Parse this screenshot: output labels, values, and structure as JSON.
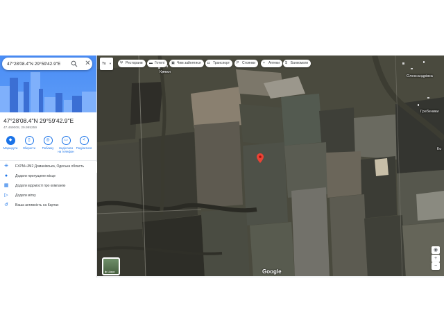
{
  "search": {
    "value": "47°28'08.4\"N 29°59'42.9\"E",
    "close_icon": "close-icon",
    "search_icon": "search-icon"
  },
  "place": {
    "title": "47°28'08.4\"N 29°59'42.9\"E",
    "subtitle": "47.469008, 29.995259"
  },
  "actions": [
    {
      "label": "Маршрути",
      "icon": "directions-icon"
    },
    {
      "label": "Зберегти",
      "icon": "bookmark-icon"
    },
    {
      "label": "Поблизу",
      "icon": "nearby-icon"
    },
    {
      "label": "Надіслати на телефон",
      "icon": "phone-icon"
    },
    {
      "label": "Поділитися",
      "icon": "share-icon"
    }
  ],
  "details": [
    {
      "text": "FXPM+JM2 Доманівська, Одеська область",
      "icon": "pluscode-icon"
    },
    {
      "text": "Додати пропущене місце",
      "icon": "add-place-icon"
    },
    {
      "text": "Додати відомості про компанію",
      "icon": "business-icon"
    },
    {
      "text": "Додати мітку",
      "icon": "label-icon"
    },
    {
      "text": "Ваша активність на Картах",
      "icon": "history-icon"
    }
  ],
  "map": {
    "lang_label": "Yo",
    "chips": [
      {
        "label": "Ресторани",
        "icon": "restaurant-icon"
      },
      {
        "label": "Готелі",
        "icon": "hotel-icon"
      },
      {
        "label": "Чим зайнятися",
        "icon": "activities-icon"
      },
      {
        "label": "Транспорт",
        "icon": "transit-icon"
      },
      {
        "label": "Стоянки",
        "icon": "parking-icon"
      },
      {
        "label": "Аптеки",
        "icon": "pharmacy-icon"
      },
      {
        "label": "Банкомати",
        "icon": "atm-icon"
      }
    ],
    "places": [
      "Кряжи",
      "Олександрівка",
      "Гребеники",
      "Ко"
    ],
    "brand": "Google",
    "layers_label": "Шари",
    "accent": "#1a73e8",
    "pin_color": "#ea4335"
  }
}
